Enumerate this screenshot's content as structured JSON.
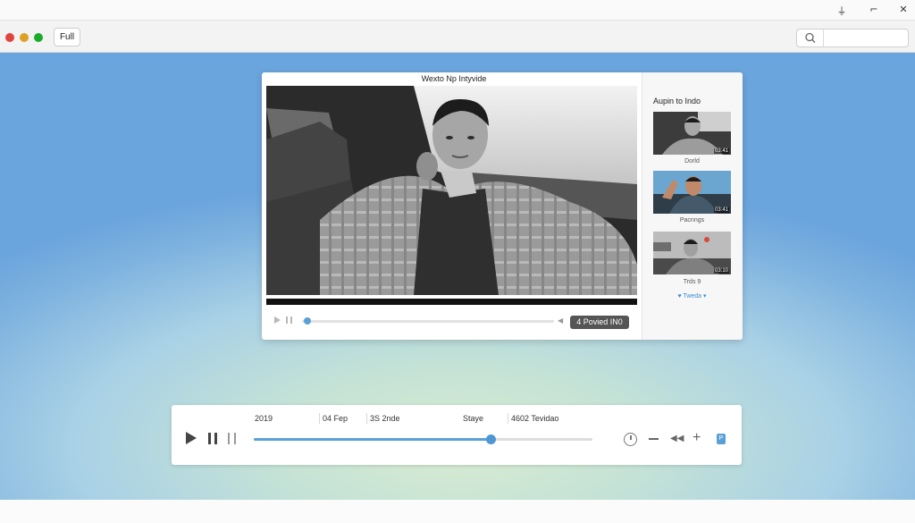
{
  "os_bar": {
    "controls": [
      {
        "name": "signal",
        "glyph": "⏚"
      },
      {
        "name": "restore",
        "glyph": "⌐"
      },
      {
        "name": "close",
        "glyph": "✕"
      }
    ]
  },
  "toolbar": {
    "traffic_lights": {
      "close": "#e0443e",
      "minimize": "#dea123",
      "maximize": "#1aab29"
    },
    "full_button": "Full",
    "search_placeholder": ""
  },
  "player": {
    "title": "Wexto Np Intyvide",
    "badge": "4 Povied IN0",
    "progress": 0.02,
    "accent": "#5aa0d8"
  },
  "sidebar": {
    "title": "Aupin to Indo",
    "items": [
      {
        "caption": "Dorld",
        "time": "03:41"
      },
      {
        "caption": "Pacnngs",
        "time": "03:41"
      },
      {
        "caption": "Trds 9",
        "time": "03:10"
      }
    ],
    "link": "♥ Tweda ▾"
  },
  "controls": {
    "meta": [
      "2019",
      "04 Fep",
      "3S 2nde",
      "Staye",
      "4602 Tevidao"
    ],
    "progress": 0.7
  }
}
